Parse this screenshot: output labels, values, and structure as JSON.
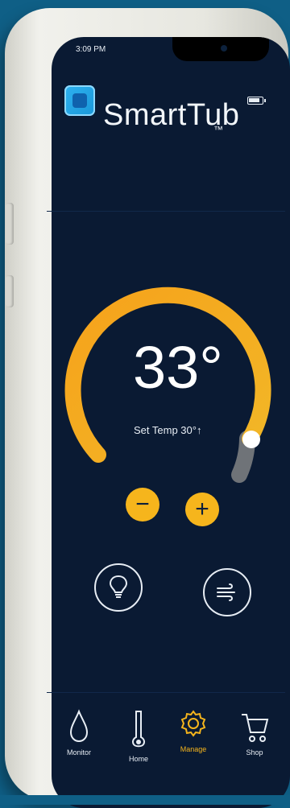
{
  "status": {
    "time": "3:09 PM"
  },
  "app": {
    "title": "SmartTub",
    "trademark": "™"
  },
  "temperature": {
    "current": "33°",
    "set_label": "Set Temp 30°↑"
  },
  "controls": {
    "minus": "−",
    "plus": "+"
  },
  "nav": {
    "items": [
      {
        "label": "Monitor",
        "icon": "drop-icon"
      },
      {
        "label": "Home",
        "icon": "thermometer-icon"
      },
      {
        "label": "Manage",
        "icon": "gear-icon"
      },
      {
        "label": "Shop",
        "icon": "cart-icon"
      }
    ]
  },
  "colors": {
    "accent": "#f6b51c",
    "screen_bg": "#0a1a33",
    "brand_blue": "#2eb2f0"
  }
}
